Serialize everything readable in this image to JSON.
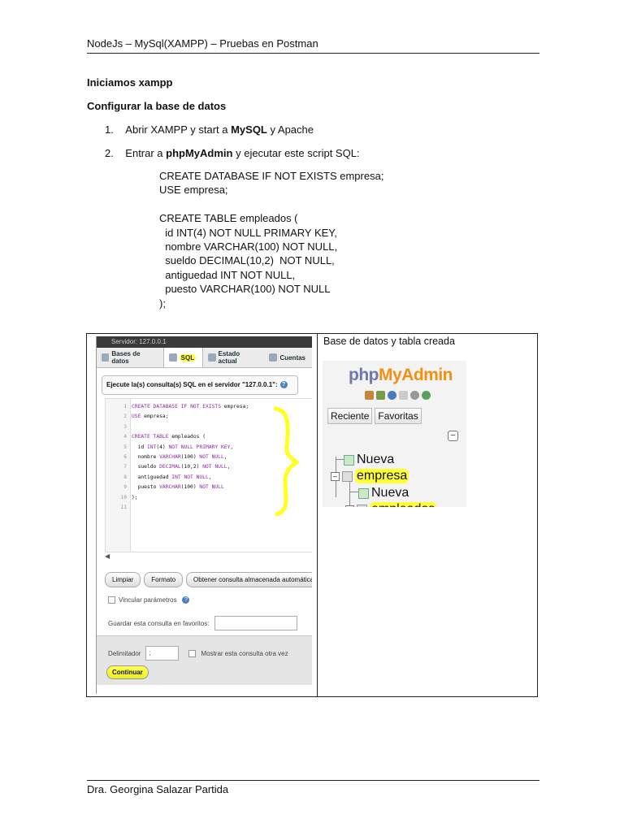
{
  "header": {
    "title": "NodeJs – MySql(XAMPP) – Pruebas en Postman"
  },
  "sections": {
    "title1": "Iniciamos xampp",
    "title2": "Configurar  la base de datos"
  },
  "steps": [
    {
      "num": "1.",
      "pre": "Abrir XAMPP y start a ",
      "bold": "MySQL",
      "post": " y Apache"
    },
    {
      "num": "2.",
      "pre": "Entrar a ",
      "bold": "phpMyAdmin",
      "post": " y ejecutar este script SQL:"
    }
  ],
  "sql_script": "CREATE DATABASE IF NOT EXISTS empresa;\nUSE empresa;\n\nCREATE TABLE empleados (\n  id INT(4) NOT NULL PRIMARY KEY,\n  nombre VARCHAR(100) NOT NULL,\n  sueldo DECIMAL(10,2)  NOT NULL,\n  antiguedad INT NOT NULL,\n  puesto VARCHAR(100) NOT NULL\n);",
  "table_caption": "Base de datos y tabla creada",
  "left_screenshot": {
    "server_title": "Servidor: 127.0.0.1",
    "tabs": [
      "Bases de datos",
      "SQL",
      "Estado actual",
      "Cuentas"
    ],
    "query_box": "Ejecute la(s) consulta(s) SQL en el servidor \"127.0.0.1\":",
    "code_lines": [
      {
        "n": "1",
        "text": "CREATE DATABASE IF NOT EXISTS empresa;"
      },
      {
        "n": "2",
        "text": "USE empresa;"
      },
      {
        "n": "3",
        "text": ""
      },
      {
        "n": "4",
        "text": "CREATE TABLE empleados ("
      },
      {
        "n": "5",
        "text": "  id INT(4) NOT NULL PRIMARY KEY,"
      },
      {
        "n": "6",
        "text": "  nombre VARCHAR(100) NOT NULL,"
      },
      {
        "n": "7",
        "text": "  sueldo DECIMAL(10,2) NOT NULL,"
      },
      {
        "n": "8",
        "text": "  antiguedad INT NOT NULL,"
      },
      {
        "n": "9",
        "text": "  puesto VARCHAR(100) NOT NULL"
      },
      {
        "n": "10",
        "text": ");"
      },
      {
        "n": "11",
        "text": ""
      }
    ],
    "btn_clear": "Limpiar",
    "btn_format": "Formato",
    "btn_stored": "Obtener consulta almacenada automáticam",
    "bind_params": "Vincular parámetros",
    "save_fav": "Guardar esta consulta en favoritos:",
    "delimiter_label": "Delimitador",
    "delimiter_value": ";",
    "show_again": "Mostrar esta consulta otra vez",
    "go": "Continuar"
  },
  "right_screenshot": {
    "logo_a": "php",
    "logo_b": "MyAdmin",
    "tab_recent": "Reciente",
    "tab_fav": "Favoritas",
    "tree_new": "Nueva",
    "tree_db": "empresa",
    "tree_new2": "Nueva",
    "tree_table": "empleados"
  },
  "footer": {
    "author": "Dra. Georgina Salazar Partida"
  },
  "colors": {
    "highlight": "#ffff33",
    "logo_php": "#6c78af",
    "logo_myadmin": "#f29111"
  }
}
